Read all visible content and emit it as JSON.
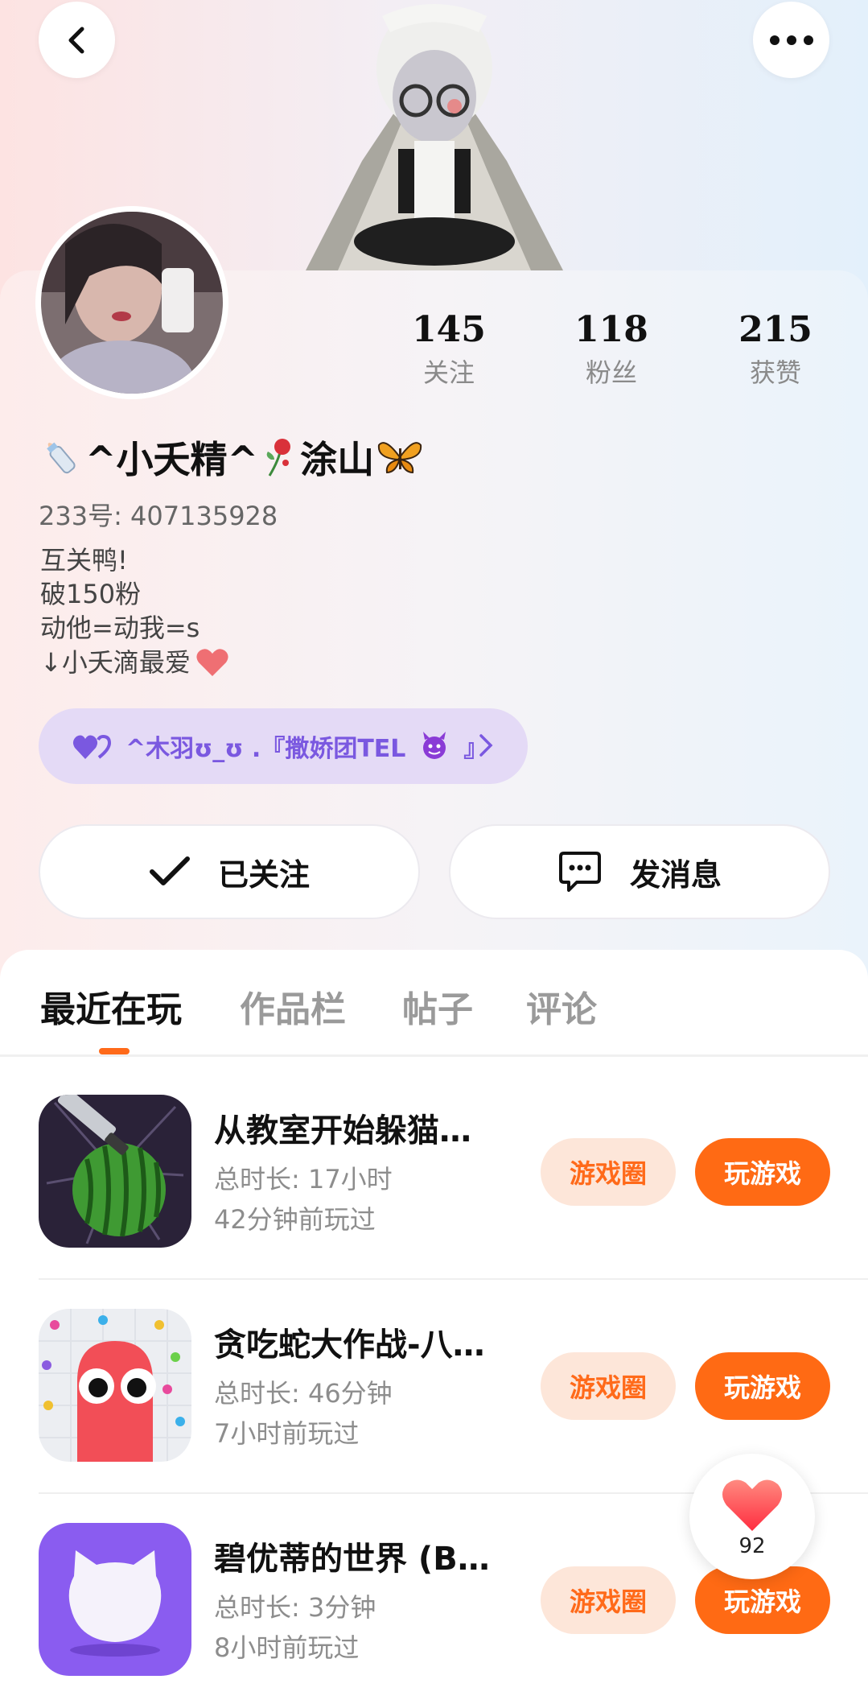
{
  "header": {
    "back_icon": "chevron-left-icon",
    "more_icon": "more-horizontal-icon"
  },
  "profile": {
    "nickname": "^小夭精^",
    "nickname_suffix": "涂山",
    "id_line": "233号: 407135928",
    "bio": [
      "互关鸭!",
      "破150粉",
      "动他=动我=s",
      "↓小夭滴最爱"
    ],
    "stats": [
      {
        "value": "145",
        "label": "关注"
      },
      {
        "value": "118",
        "label": "粉丝"
      },
      {
        "value": "215",
        "label": "获赞"
      }
    ],
    "cp_label": "^木羽ʊ_ʊ .『撒娇团TEL",
    "cp_label_end": "』"
  },
  "actions": {
    "followed_label": "已关注",
    "message_label": "发消息"
  },
  "tabs": [
    {
      "label": "最近在玩",
      "active": true
    },
    {
      "label": "作品栏",
      "active": false
    },
    {
      "label": "帖子",
      "active": false
    },
    {
      "label": "评论",
      "active": false
    }
  ],
  "games": [
    {
      "title": "从教室开始躲猫…",
      "duration": "总时长: 17小时",
      "last_played": "42分钟前玩过",
      "circle_label": "游戏圈",
      "play_label": "玩游戏"
    },
    {
      "title": "贪吃蛇大作战-八…",
      "duration": "总时长: 46分钟",
      "last_played": "7小时前玩过",
      "circle_label": "游戏圈",
      "play_label": "玩游戏"
    },
    {
      "title": "碧优蒂的世界 (B…",
      "duration": "总时长: 3分钟",
      "last_played": "8小时前玩过",
      "circle_label": "游戏圈",
      "play_label": "玩游戏"
    }
  ],
  "like_float": {
    "count": "92",
    "icon": "heart-icon"
  },
  "colors": {
    "accent": "#ff6a14",
    "accent_light": "#fde6d9",
    "cp_purple": "#7a58e0"
  }
}
